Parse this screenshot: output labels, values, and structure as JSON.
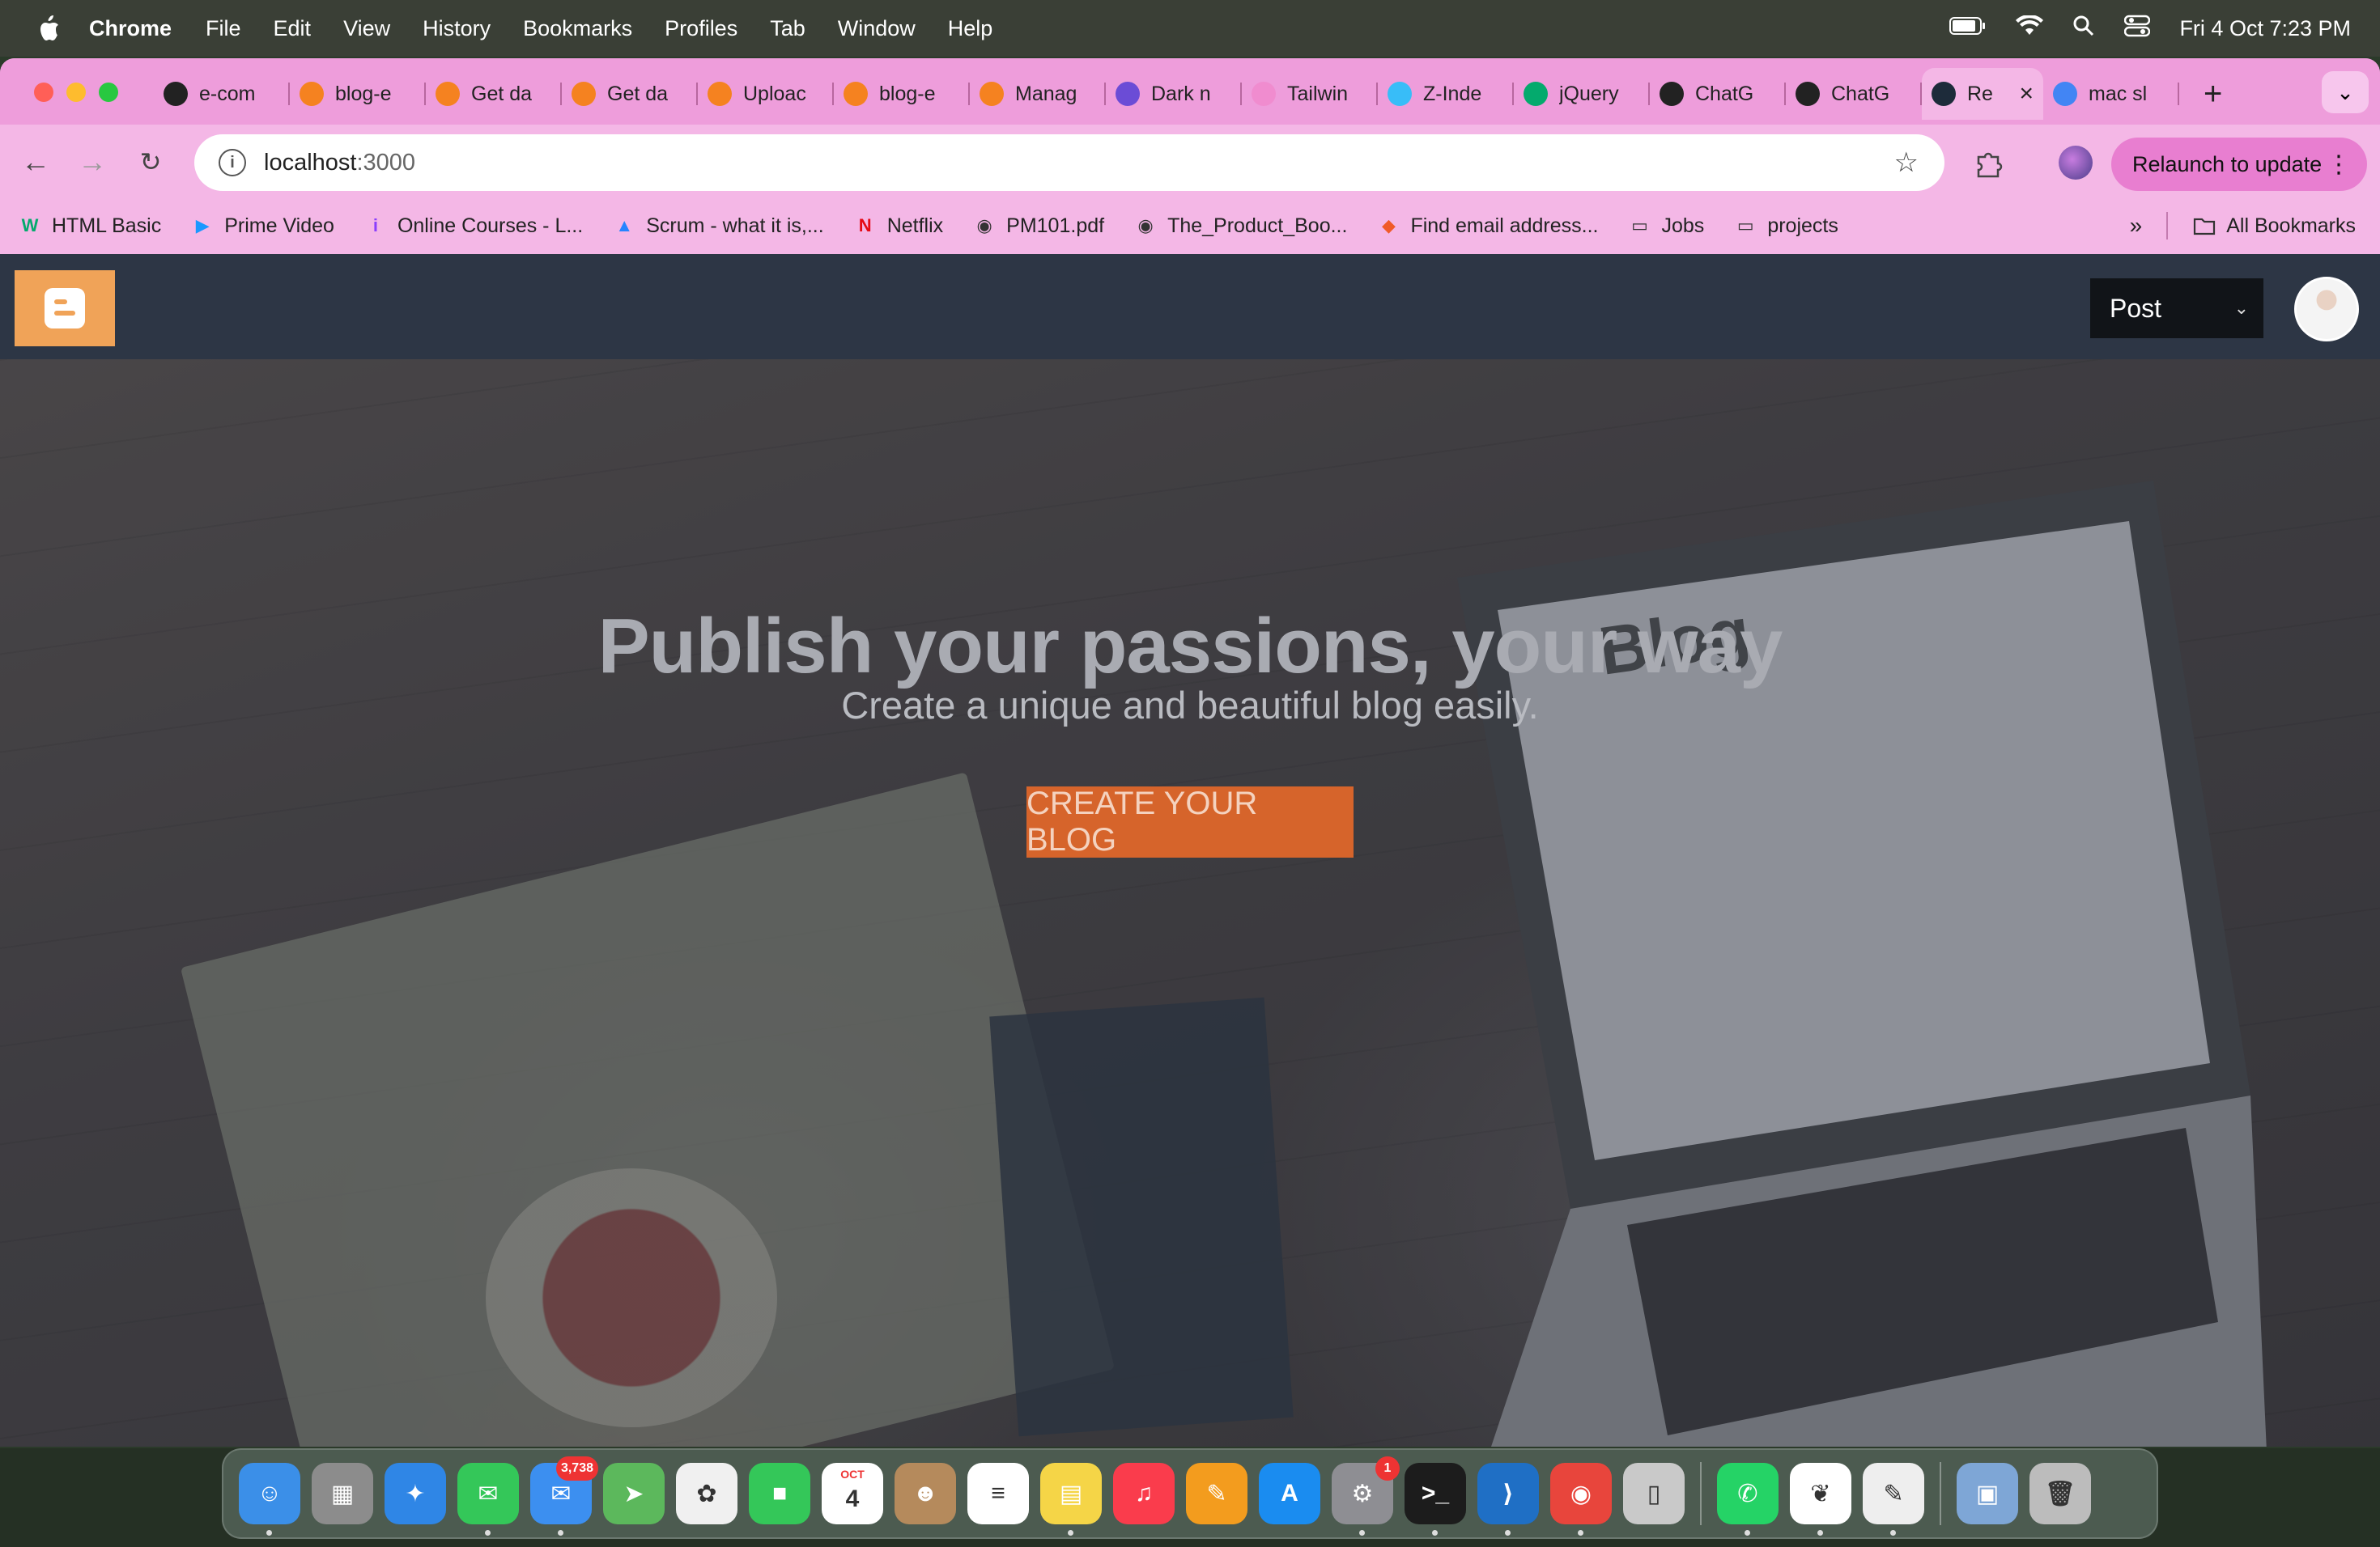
{
  "menubar": {
    "app_name": "Chrome",
    "items": [
      "File",
      "Edit",
      "View",
      "History",
      "Bookmarks",
      "Profiles",
      "Tab",
      "Window",
      "Help"
    ],
    "clock": "Fri 4 Oct  7:23 PM"
  },
  "tabs": [
    {
      "title": "e-com",
      "icon": "github-icon",
      "color": "#222222"
    },
    {
      "title": "blog-e",
      "icon": "firebase-icon",
      "color": "#f58220"
    },
    {
      "title": "Get da",
      "icon": "firebase-icon",
      "color": "#f58220"
    },
    {
      "title": "Get da",
      "icon": "firebase-icon",
      "color": "#f58220"
    },
    {
      "title": "Uploac",
      "icon": "firebase-icon",
      "color": "#f58220"
    },
    {
      "title": "blog-e",
      "icon": "firebase-icon",
      "color": "#f58220"
    },
    {
      "title": "Manag",
      "icon": "firebase-icon",
      "color": "#f58220"
    },
    {
      "title": "Dark n",
      "icon": "tool-icon",
      "color": "#6b4cd6"
    },
    {
      "title": "Tailwin",
      "icon": "tailwind-icon",
      "color": "#f08ccf"
    },
    {
      "title": "Z-Inde",
      "icon": "tailwind-icon",
      "color": "#38bdf8"
    },
    {
      "title": "jQuery",
      "icon": "w3schools-icon",
      "color": "#04aa6d"
    },
    {
      "title": "ChatG",
      "icon": "chatgpt-icon",
      "color": "#222222"
    },
    {
      "title": "ChatG",
      "icon": "chatgpt-icon",
      "color": "#222222"
    },
    {
      "title": "Re",
      "icon": "react-icon",
      "color": "#1d2b3a",
      "active": true
    },
    {
      "title": "mac sl",
      "icon": "google-icon",
      "color": "#4285f4"
    }
  ],
  "toolbar": {
    "url_host": "localhost",
    "url_port": ":3000",
    "relaunch_label": "Relaunch to update"
  },
  "bookmarks": {
    "items": [
      {
        "label": "HTML Basic",
        "icon": "w3schools-icon",
        "glyph": "W",
        "color": "#04aa6d"
      },
      {
        "label": "Prime Video",
        "icon": "prime-video-icon",
        "glyph": "▶",
        "color": "#1a98ff"
      },
      {
        "label": "Online Courses - L...",
        "icon": "udemy-icon",
        "glyph": "i",
        "color": "#8a3ffc"
      },
      {
        "label": "Scrum - what it is,...",
        "icon": "atlassian-icon",
        "glyph": "▲",
        "color": "#2684ff"
      },
      {
        "label": "Netflix",
        "icon": "netflix-icon",
        "glyph": "N",
        "color": "#e50914"
      },
      {
        "label": "PM101.pdf",
        "icon": "globe-icon",
        "glyph": "◉",
        "color": "#333333"
      },
      {
        "label": "The_Product_Boo...",
        "icon": "globe-icon",
        "glyph": "◉",
        "color": "#333333"
      },
      {
        "label": "Find email address...",
        "icon": "hunter-icon",
        "glyph": "◆",
        "color": "#f05a28"
      },
      {
        "label": "Jobs",
        "icon": "folder-icon",
        "glyph": "▭",
        "color": "#333333"
      },
      {
        "label": "projects",
        "icon": "folder-icon",
        "glyph": "▭",
        "color": "#333333"
      }
    ],
    "all_label": "All Bookmarks"
  },
  "app": {
    "post_select": "Post",
    "hero_title": "Publish your passions, your way",
    "hero_subtitle": "Create a unique and beautiful blog easily.",
    "cta_label": "CREATE YOUR BLOG",
    "laptop_screen_text": "Blog"
  },
  "dock": {
    "apps": [
      {
        "name": "finder-icon",
        "color": "#3b8fe8",
        "glyph": "☺",
        "running": true
      },
      {
        "name": "launchpad-icon",
        "color": "#8c8c8c",
        "glyph": "▦",
        "running": false
      },
      {
        "name": "safari-icon",
        "color": "#2f86e6",
        "glyph": "✦",
        "running": false
      },
      {
        "name": "messages-icon",
        "color": "#34c759",
        "glyph": "✉",
        "running": true
      },
      {
        "name": "mail-icon",
        "color": "#3c8ff0",
        "glyph": "✉",
        "running": true,
        "badge": "3,738"
      },
      {
        "name": "maps-icon",
        "color": "#5cb85c",
        "glyph": "➤",
        "running": false
      },
      {
        "name": "photos-icon",
        "color": "#f0f0f0",
        "glyph": "✿",
        "running": false
      },
      {
        "name": "facetime-icon",
        "color": "#34c759",
        "glyph": "■",
        "running": false
      },
      {
        "name": "calendar-icon",
        "color": "#ffffff",
        "glyph": "4",
        "running": false,
        "month": "OCT"
      },
      {
        "name": "contacts-icon",
        "color": "#b58a5c",
        "glyph": "☻",
        "running": false
      },
      {
        "name": "reminders-icon",
        "color": "#ffffff",
        "glyph": "≡",
        "running": false
      },
      {
        "name": "notes-icon",
        "color": "#f5d547",
        "glyph": "▤",
        "running": true
      },
      {
        "name": "music-icon",
        "color": "#fa3c4c",
        "glyph": "♫",
        "running": false
      },
      {
        "name": "pages-icon",
        "color": "#f39c1e",
        "glyph": "✎",
        "running": false
      },
      {
        "name": "app-store-icon",
        "color": "#1a8cf0",
        "glyph": "A",
        "running": false
      },
      {
        "name": "system-settings-icon",
        "color": "#8e8e93",
        "glyph": "⚙",
        "running": true,
        "badge": "1"
      },
      {
        "name": "terminal-icon",
        "color": "#1c1c1c",
        "glyph": ">_",
        "running": true
      },
      {
        "name": "vscode-icon",
        "color": "#1f6fc5",
        "glyph": "⟩",
        "running": true
      },
      {
        "name": "chrome-icon",
        "color": "#e8453c",
        "glyph": "◉",
        "running": true
      },
      {
        "name": "iphone-mirroring-icon",
        "color": "#c9c9c9",
        "glyph": "▯",
        "running": false
      }
    ],
    "recent_apps": [
      {
        "name": "whatsapp-icon",
        "color": "#25d366",
        "glyph": "✆",
        "running": true
      },
      {
        "name": "mongodb-compass-icon",
        "color": "#ffffff",
        "glyph": "❦",
        "running": true
      },
      {
        "name": "textedit-icon",
        "color": "#eeeeee",
        "glyph": "✎",
        "running": true
      }
    ],
    "trailing": [
      {
        "name": "downloads-stack-icon",
        "color": "#7ea6d6",
        "glyph": "▣",
        "running": false
      },
      {
        "name": "trash-icon",
        "color": "#bcbcbc",
        "glyph": "🗑",
        "running": false
      }
    ]
  }
}
